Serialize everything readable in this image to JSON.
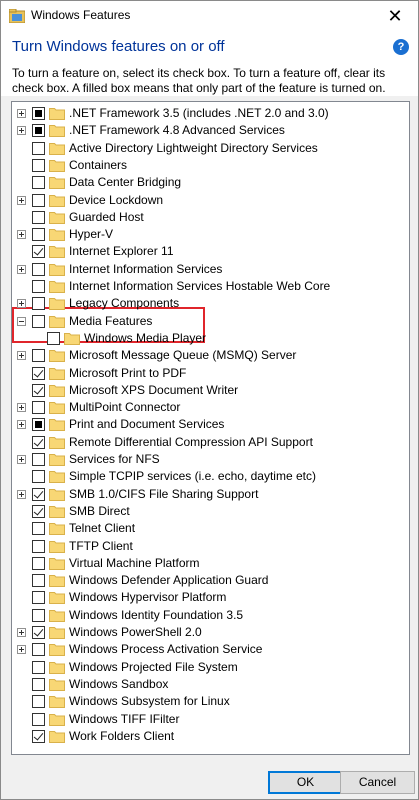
{
  "window": {
    "title": "Windows Features",
    "heading": "Turn Windows features on or off",
    "description": "To turn a feature on, select its check box. To turn a feature off, clear its check box. A filled box means that only part of the feature is turned on."
  },
  "buttons": {
    "ok": "OK",
    "cancel": "Cancel"
  },
  "colors": {
    "heading": "#003399",
    "highlight_border": "#e0252b",
    "folder": "#f8d775"
  },
  "features": [
    {
      "label": ".NET Framework 3.5 (includes .NET 2.0 and 3.0)",
      "state": "partial",
      "expandable": true,
      "level": 0
    },
    {
      "label": ".NET Framework 4.8 Advanced Services",
      "state": "partial",
      "expandable": true,
      "level": 0
    },
    {
      "label": "Active Directory Lightweight Directory Services",
      "state": "unchecked",
      "expandable": false,
      "level": 0
    },
    {
      "label": "Containers",
      "state": "unchecked",
      "expandable": false,
      "level": 0
    },
    {
      "label": "Data Center Bridging",
      "state": "unchecked",
      "expandable": false,
      "level": 0
    },
    {
      "label": "Device Lockdown",
      "state": "unchecked",
      "expandable": true,
      "level": 0
    },
    {
      "label": "Guarded Host",
      "state": "unchecked",
      "expandable": false,
      "level": 0
    },
    {
      "label": "Hyper-V",
      "state": "unchecked",
      "expandable": true,
      "level": 0
    },
    {
      "label": "Internet Explorer 11",
      "state": "checked",
      "expandable": false,
      "level": 0
    },
    {
      "label": "Internet Information Services",
      "state": "unchecked",
      "expandable": true,
      "level": 0
    },
    {
      "label": "Internet Information Services Hostable Web Core",
      "state": "unchecked",
      "expandable": false,
      "level": 0
    },
    {
      "label": "Legacy Components",
      "state": "unchecked",
      "expandable": true,
      "level": 0
    },
    {
      "label": "Media Features",
      "state": "unchecked",
      "expandable": "expanded",
      "level": 0
    },
    {
      "label": "Windows Media Player",
      "state": "unchecked",
      "expandable": false,
      "level": 1
    },
    {
      "label": "Microsoft Message Queue (MSMQ) Server",
      "state": "unchecked",
      "expandable": true,
      "level": 0
    },
    {
      "label": "Microsoft Print to PDF",
      "state": "checked",
      "expandable": false,
      "level": 0
    },
    {
      "label": "Microsoft XPS Document Writer",
      "state": "checked",
      "expandable": false,
      "level": 0
    },
    {
      "label": "MultiPoint Connector",
      "state": "unchecked",
      "expandable": true,
      "level": 0
    },
    {
      "label": "Print and Document Services",
      "state": "partial",
      "expandable": true,
      "level": 0
    },
    {
      "label": "Remote Differential Compression API Support",
      "state": "checked",
      "expandable": false,
      "level": 0
    },
    {
      "label": "Services for NFS",
      "state": "unchecked",
      "expandable": true,
      "level": 0
    },
    {
      "label": "Simple TCPIP services (i.e. echo, daytime etc)",
      "state": "unchecked",
      "expandable": false,
      "level": 0
    },
    {
      "label": "SMB 1.0/CIFS File Sharing Support",
      "state": "checked",
      "expandable": true,
      "level": 0
    },
    {
      "label": "SMB Direct",
      "state": "checked",
      "expandable": false,
      "level": 0
    },
    {
      "label": "Telnet Client",
      "state": "unchecked",
      "expandable": false,
      "level": 0
    },
    {
      "label": "TFTP Client",
      "state": "unchecked",
      "expandable": false,
      "level": 0
    },
    {
      "label": "Virtual Machine Platform",
      "state": "unchecked",
      "expandable": false,
      "level": 0
    },
    {
      "label": "Windows Defender Application Guard",
      "state": "unchecked",
      "expandable": false,
      "level": 0
    },
    {
      "label": "Windows Hypervisor Platform",
      "state": "unchecked",
      "expandable": false,
      "level": 0
    },
    {
      "label": "Windows Identity Foundation 3.5",
      "state": "unchecked",
      "expandable": false,
      "level": 0
    },
    {
      "label": "Windows PowerShell 2.0",
      "state": "checked",
      "expandable": true,
      "level": 0
    },
    {
      "label": "Windows Process Activation Service",
      "state": "unchecked",
      "expandable": true,
      "level": 0
    },
    {
      "label": "Windows Projected File System",
      "state": "unchecked",
      "expandable": false,
      "level": 0
    },
    {
      "label": "Windows Sandbox",
      "state": "unchecked",
      "expandable": false,
      "level": 0
    },
    {
      "label": "Windows Subsystem for Linux",
      "state": "unchecked",
      "expandable": false,
      "level": 0
    },
    {
      "label": "Windows TIFF IFilter",
      "state": "unchecked",
      "expandable": false,
      "level": 0
    },
    {
      "label": "Work Folders Client",
      "state": "checked",
      "expandable": false,
      "level": 0
    }
  ]
}
